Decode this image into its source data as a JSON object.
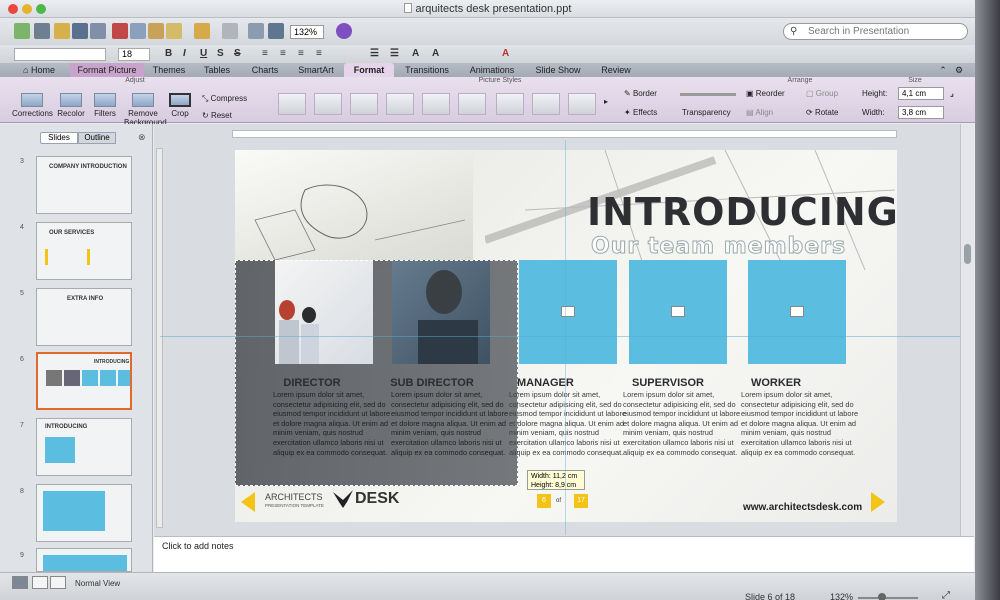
{
  "window": {
    "title": "arquitects desk presentation.ppt"
  },
  "toolbar": {
    "zoom": "132%",
    "search_placeholder": "Search in Presentation"
  },
  "formatbar": {
    "font_size": "18"
  },
  "tabs": [
    "Home",
    "Format Picture",
    "Themes",
    "Tables",
    "Charts",
    "SmartArt",
    "Format",
    "Transitions",
    "Animations",
    "Slide Show",
    "Review"
  ],
  "ribbon": {
    "groups": {
      "adjust": "Adjust",
      "picture_styles": "Picture Styles",
      "arrange": "Arrange",
      "size": "Size"
    },
    "corrections": "Corrections",
    "recolor": "Recolor",
    "filters": "Filters",
    "remove_background": "Remove Background",
    "crop": "Crop",
    "compress": "Compress",
    "reset": "Reset",
    "border": "Border",
    "effects": "Effects",
    "transparency": "Transparency",
    "reorder": "Reorder",
    "align": "Align",
    "group": "Group",
    "rotate": "Rotate",
    "height_label": "Height:",
    "height_value": "4,1 cm",
    "width_label": "Width:",
    "width_value": "3,8 cm"
  },
  "leftpanel": {
    "tab_slides": "Slides",
    "tab_outline": "Outline",
    "slide_numbers": [
      "3",
      "4",
      "5",
      "6",
      "7",
      "8",
      "9"
    ],
    "thumb_titles": [
      "COMPANY INTRODUCTION",
      "OUR SERVICES",
      "EXTRA INFO",
      "INTRODUCING",
      "INTRODUCING",
      "",
      ""
    ]
  },
  "slide": {
    "title": "INTRODUCING",
    "subtitle": "Our team members",
    "roles": [
      "DIRECTOR",
      "SUB DIRECTOR",
      "MANAGER",
      "SUPERVISOR",
      "WORKER"
    ],
    "lorem": "Lorem ipsum dolor sit amet, consectetur adipisicing elit, sed do eiusmod tempor incididunt ut labore et dolore magna aliqua. Ut enim ad minim veniam, quis nostrud exercitation ullamco laboris nisi ut aliquip ex ea commodo consequat.",
    "size_tooltip_width": "Width: 11,2 cm",
    "size_tooltip_height": "Height: 8,9 cm",
    "logo_text": "ARCHITECTS",
    "logo_desk": "DESK",
    "logo_sub": "PRESENTATION TEMPLATE",
    "page_current": "6",
    "page_of": "of",
    "page_total": "17",
    "website": "www.architectsdesk.com"
  },
  "notes": {
    "placeholder": "Click to add notes"
  },
  "status": {
    "view": "Normal View",
    "slide_of": "Slide 6 of 18",
    "zoom": "132%"
  },
  "colors": {
    "accent_blue": "#5bbde0",
    "accent_yellow": "#f3c316",
    "selection_orange": "#e06a2c",
    "ribbon_context": "#c8a4cc"
  }
}
